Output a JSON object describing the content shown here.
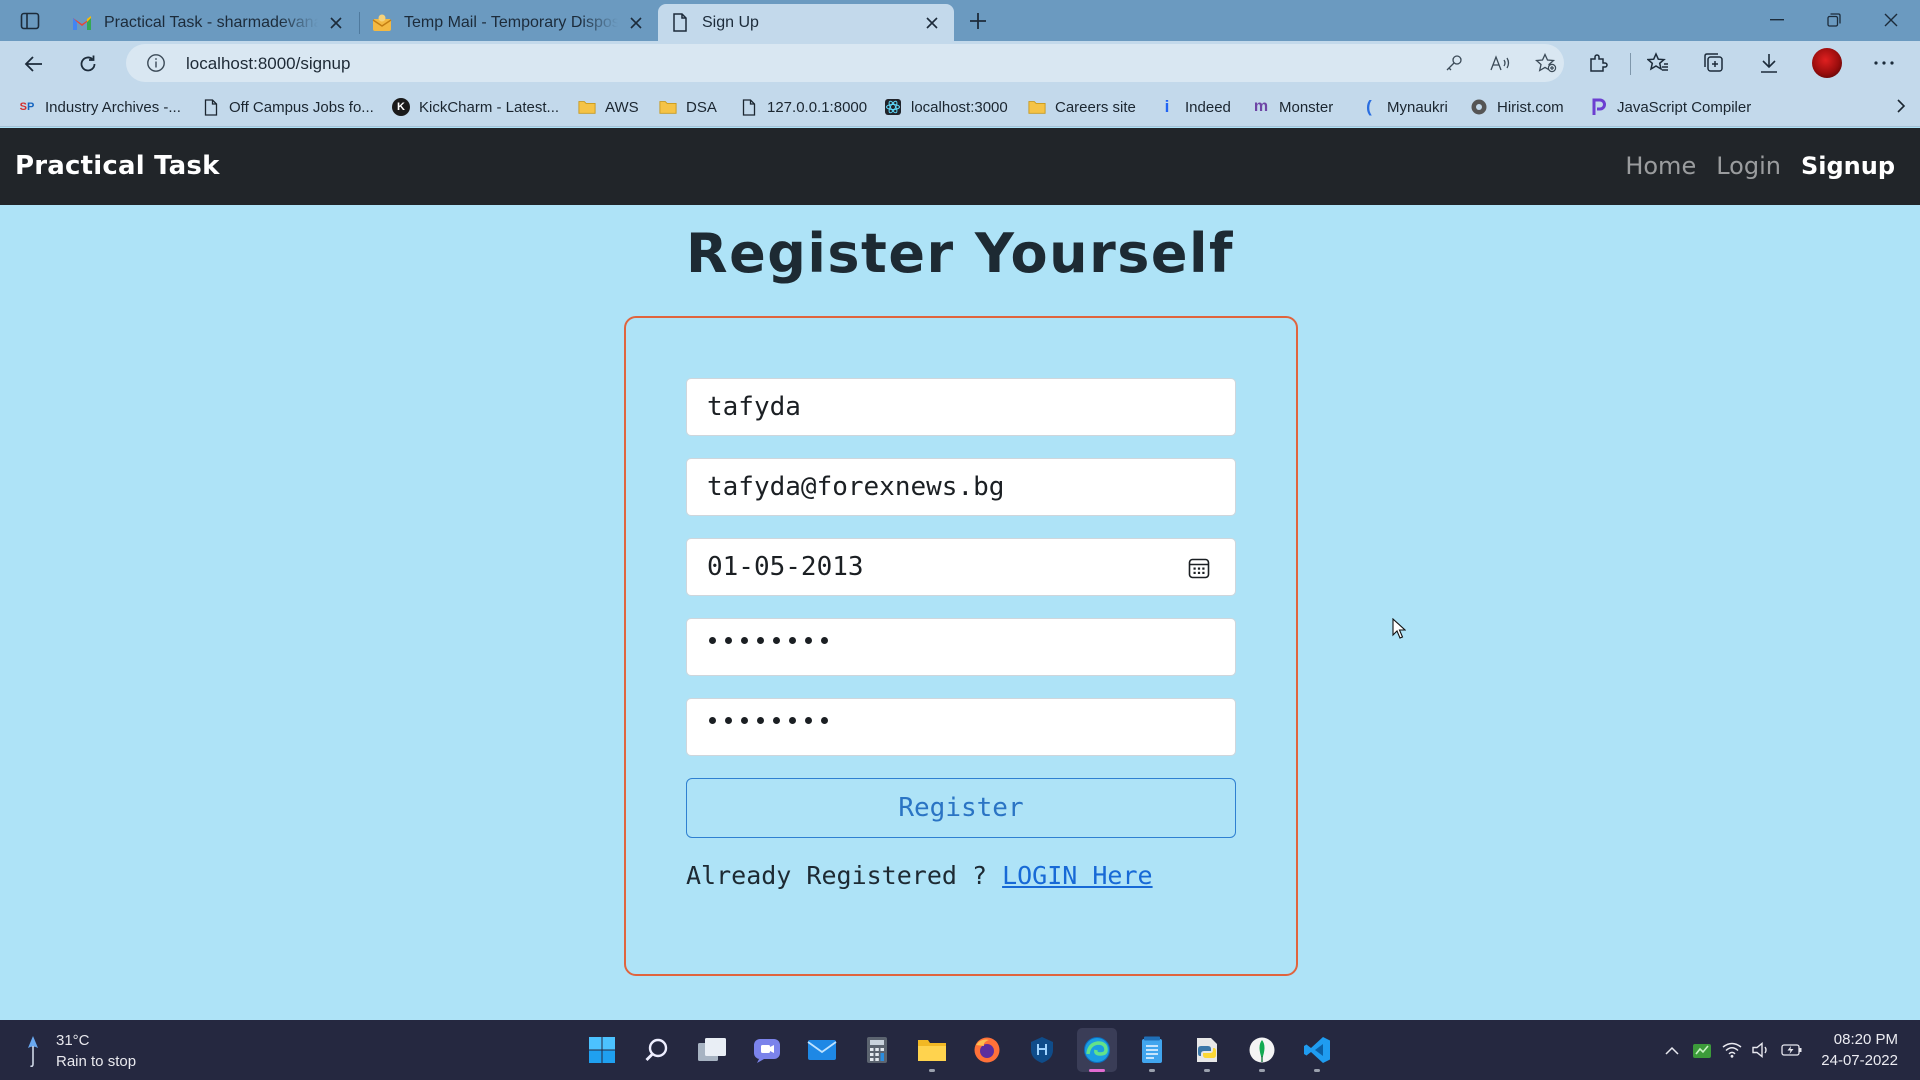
{
  "browser": {
    "tabs": [
      {
        "title": "Practical Task - sharmadevanand",
        "icon": "gmail-icon",
        "active": false
      },
      {
        "title": "Temp Mail - Temporary Disposab",
        "icon": "tempmail-icon",
        "active": false
      },
      {
        "title": "Sign Up",
        "icon": "page-icon",
        "active": true
      }
    ],
    "address": "localhost:8000/signup",
    "bookmarks": [
      {
        "label": "Industry Archives -...",
        "icon": "sp-logo-icon"
      },
      {
        "label": "Off Campus Jobs fo...",
        "icon": "page-icon"
      },
      {
        "label": "KickCharm - Latest...",
        "icon": "kickcharm-icon"
      },
      {
        "label": "AWS",
        "icon": "folder-icon"
      },
      {
        "label": "DSA",
        "icon": "folder-icon"
      },
      {
        "label": "127.0.0.1:8000",
        "icon": "page-icon"
      },
      {
        "label": "localhost:3000",
        "icon": "react-icon"
      },
      {
        "label": "Careers site",
        "icon": "folder-icon"
      },
      {
        "label": "Indeed",
        "icon": "indeed-icon"
      },
      {
        "label": "Monster",
        "icon": "monster-icon"
      },
      {
        "label": "Mynaukri",
        "icon": "naukri-icon"
      },
      {
        "label": "Hirist.com",
        "icon": "hirist-icon"
      },
      {
        "label": "JavaScript Compiler",
        "icon": "programiz-icon"
      }
    ]
  },
  "site": {
    "brand": "Practical Task",
    "nav": {
      "home": "Home",
      "login": "Login",
      "signup": "Signup"
    }
  },
  "form": {
    "heading": "Register Yourself",
    "name_value": "tafyda",
    "email_value": "tafyda@forexnews.bg",
    "dob_value": "01-05-2013",
    "password_length": 8,
    "confirm_password_length": 8,
    "submit_label": "Register",
    "already_text": "Already Registered ? ",
    "login_link": "LOGIN Here"
  },
  "taskbar": {
    "temperature": "31°C",
    "weather_text": "Rain to stop",
    "time": "08:20 PM",
    "date": "24-07-2022",
    "apps": [
      "windows-start-icon",
      "search-icon",
      "task-view-icon",
      "teams-chat-icon",
      "mail-icon",
      "calculator-icon",
      "file-explorer-icon",
      "firefox-icon",
      "app-icon",
      "edge-icon",
      "notepad-icon",
      "python-icon",
      "mongodb-compass-icon",
      "vscode-icon"
    ]
  },
  "colors": {
    "page_background": "#aee3f7",
    "navbar": "#212529",
    "card_border": "#e0643e",
    "button_border": "#2f80d1",
    "link": "#1769d6"
  }
}
